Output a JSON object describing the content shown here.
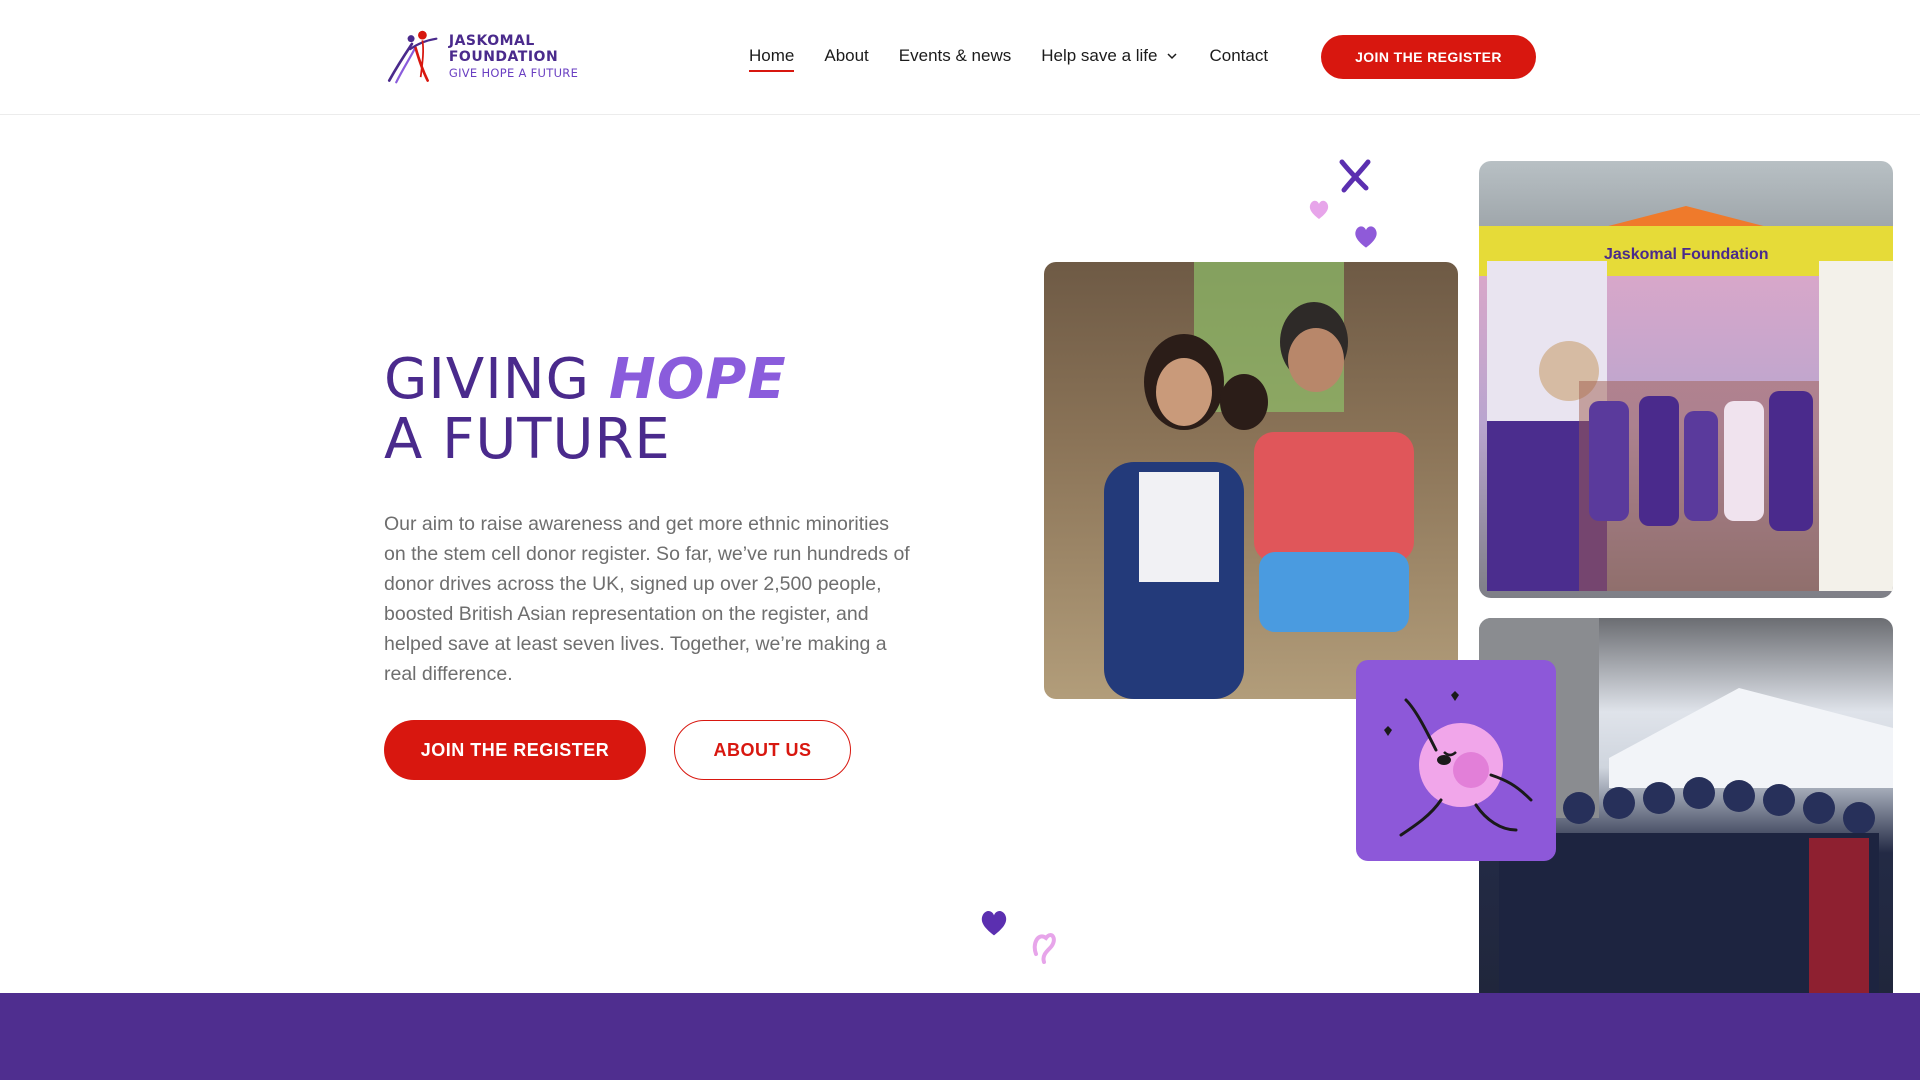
{
  "brand": {
    "name": "JASKOMAL FOUNDATION",
    "tagline": "GIVE HOPE A FUTURE",
    "colors": {
      "primary": "#4a2a8c",
      "accent": "#8a5cdc",
      "cta": "#d8170f",
      "band": "#4f2e8f"
    }
  },
  "nav": {
    "items": [
      {
        "label": "Home",
        "active": true
      },
      {
        "label": "About"
      },
      {
        "label": "Events & news"
      },
      {
        "label": "Help save a life",
        "has_dropdown": true
      },
      {
        "label": "Contact"
      }
    ],
    "cta_label": "JOIN THE REGISTER"
  },
  "hero": {
    "title_line1": "GIVING ",
    "title_accent": "HOPE",
    "title_line2": "A FUTURE",
    "description": "Our aim to raise awareness and get more ethnic minorities on the stem cell donor register. So far, we’ve run hundreds of donor drives across the UK, signed up over 2,500 people, boosted British Asian representation on the register, and helped save at least seven lives. Together, we’re making a real difference.",
    "primary_button": "JOIN THE REGISTER",
    "secondary_button": "ABOUT US"
  },
  "photos": {
    "stall_banner": "Jaskomal Foundation"
  },
  "icons": [
    "chevron-down-icon",
    "heart-icon",
    "ribbon-heart-icon",
    "logo-figures-icon"
  ]
}
